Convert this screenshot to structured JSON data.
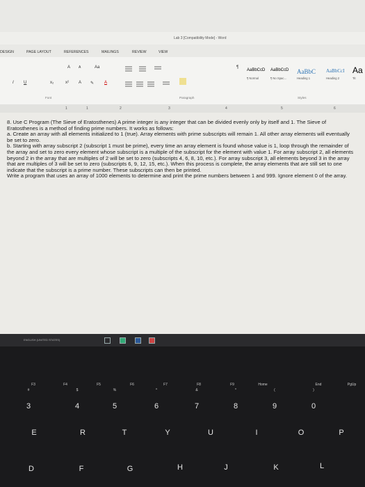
{
  "window": {
    "title": "Lab 3 [Compatibility Mode] - Word"
  },
  "tabs": [
    "DESIGN",
    "PAGE LAYOUT",
    "REFERENCES",
    "MAILINGS",
    "REVIEW",
    "VIEW"
  ],
  "ribbon": {
    "font_grow": "A",
    "font_shrink": "A",
    "change_case": "Aa",
    "bold": "I",
    "underline": "U",
    "subscript": "x₂",
    "superscript": "x²",
    "text_effects": "A",
    "highlight": "✎",
    "font_color": "A",
    "pilcrow": "¶",
    "groups": [
      "Font",
      "Paragraph",
      "Styles"
    ],
    "styles": [
      {
        "sample": "AaBbCcD",
        "name": "¶ Normal"
      },
      {
        "sample": "AaBbCcD",
        "name": "¶ No Spac..."
      },
      {
        "sample": "AaBbC",
        "name": "Heading 1"
      },
      {
        "sample": "AaBbCcI",
        "name": "Heading 2"
      },
      {
        "sample": "Aa",
        "name": "Tit"
      }
    ]
  },
  "ruler": [
    "1",
    "1",
    "2",
    "3",
    "4",
    "5",
    "6"
  ],
  "document": {
    "paragraphs": [
      "8. Use C Program (The Sieve of Eratosthenes) A prime integer is any integer that can be divided evenly only by itself and 1. The Sieve of Eratosthenes is a method of finding prime numbers. It works as follows:",
      "a. Create an array with all elements initialized to 1 (true). Array elements with prime subscripts will remain 1. All other array elements will eventually be set to zero.",
      "b. Starting with array subscript 2 (subscript 1 must be prime), every time an array element is found whose value is 1, loop through the remainder of the array and set to zero every element whose subscript is a multiple of the subscript for the element with value 1. For array subscript 2, all elements beyond 2 in the array that are multiples of 2 will be set to zero (subscripts 4, 6, 8, 10, etc.). For array subscript 3, all elements beyond 3 in the array that are multiples of 3 will be set to zero (subscripts 6, 9, 12, 15, etc.). When this process is complete, the array elements that are still set to one indicate that the subscript is a prime number. These subscripts can then be printed.",
      "Write a program that uses an array of 1000 elements to determine and print the prime numbers between 1 and 999. Ignore element 0 of the array."
    ]
  },
  "statusbar": {
    "language": "ENGLISH (UNITED STATES)"
  },
  "keyboard": {
    "fkeys": [
      "F3",
      "F4",
      "F5",
      "F6",
      "F7",
      "F8",
      "F9",
      "F10",
      "F11",
      "F12",
      "Home",
      "End",
      "PgUp"
    ],
    "number_row": [
      {
        "top": "#",
        "bottom": "3"
      },
      {
        "top": "$",
        "bottom": "4"
      },
      {
        "top": "%",
        "bottom": "5"
      },
      {
        "top": "^",
        "bottom": "6"
      },
      {
        "top": "&",
        "bottom": "7"
      },
      {
        "top": "*",
        "bottom": "8"
      },
      {
        "top": "(",
        "bottom": "9"
      },
      {
        "top": ")",
        "bottom": "0"
      }
    ],
    "row_q": [
      "E",
      "R",
      "T",
      "Y",
      "U",
      "I",
      "O",
      "P"
    ],
    "row_a": [
      "D",
      "F",
      "G",
      "H",
      "J",
      "K",
      "L"
    ]
  }
}
